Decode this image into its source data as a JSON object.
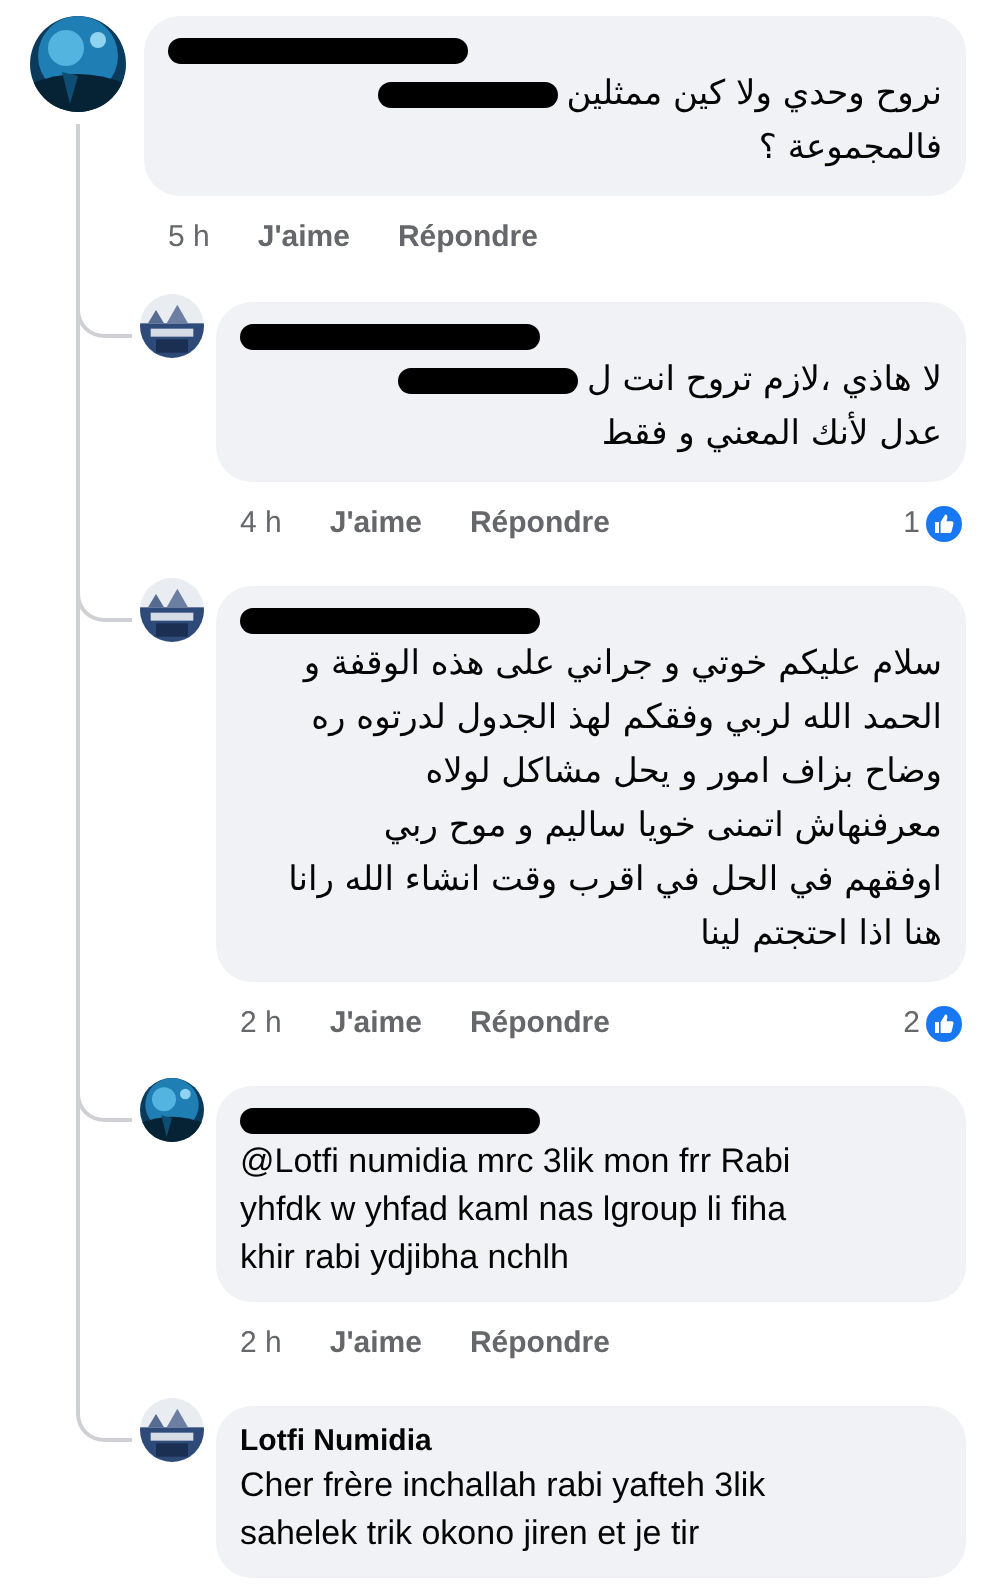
{
  "comments": [
    {
      "author_redacted": true,
      "body": {
        "kind": "mixed",
        "lines": [
          [
            {
              "kind": "text",
              "text": "نروح وحدي ولا كين ممثلين"
            },
            {
              "kind": "redaction"
            }
          ],
          [
            {
              "kind": "text",
              "text": "فالمجموعة ؟"
            }
          ]
        ]
      },
      "time": "5 h",
      "like": "J'aime",
      "reply": "Répondre",
      "replies": [
        {
          "author_redacted": true,
          "body": {
            "kind": "mixed",
            "lines": [
              [
                {
                  "kind": "text",
                  "text": "لا هاذي ،لازم تروح انت ل"
                },
                {
                  "kind": "redaction"
                }
              ],
              [
                {
                  "kind": "text",
                  "text": "عدل لأنك المعني و فقط"
                }
              ]
            ]
          },
          "time": "4 h",
          "like": "J'aime",
          "reply": "Répondre",
          "reactions": "1"
        },
        {
          "author_redacted": true,
          "body": {
            "kind": "rtl_text",
            "lines": [
              "سلام عليكم خوتي و جراني على هذه الوقفة  و",
              "الحمد الله لربي وفقكم لهذ الجدول لدرتوه ره",
              "وضاح بزاف امور و يحل مشاكل لولاه",
              "معرفنهاش اتمنى خويا ساليم و موح ربي",
              "اوفقهم في الحل في اقرب وقت انشاء الله رانا",
              "هنا اذا احتجتم لينا"
            ]
          },
          "time": "2 h",
          "like": "J'aime",
          "reply": "Répondre",
          "reactions": "2"
        },
        {
          "author_redacted": true,
          "body": {
            "kind": "ltr_text",
            "lines": [
              "@Lotfi numidia mrc 3lik mon frr Rabi",
              "yhfdk w yhfad kaml nas lgroup li fiha",
              "khir rabi ydjibha nchlh"
            ]
          },
          "time": "2 h",
          "like": "J'aime",
          "reply": "Répondre"
        },
        {
          "author_redacted": false,
          "author": "Lotfi Numidia",
          "body": {
            "kind": "ltr_text",
            "lines": [
              "Cher frère inchallah rabi yafteh 3lik",
              "sahelek trik okono jiren et je tir"
            ]
          }
        }
      ]
    }
  ]
}
